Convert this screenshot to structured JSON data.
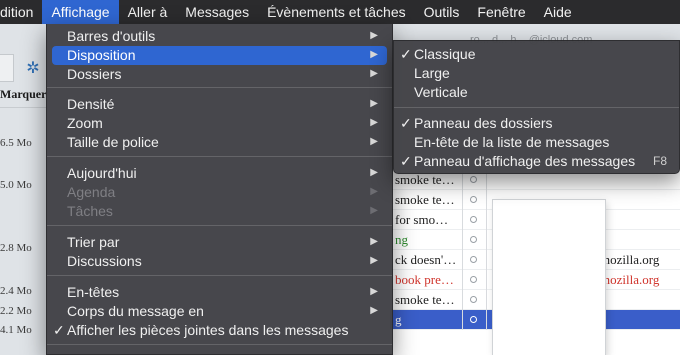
{
  "menubar": {
    "items": [
      {
        "label": "dition"
      },
      {
        "label": "Affichage"
      },
      {
        "label": "Aller à"
      },
      {
        "label": "Messages"
      },
      {
        "label": "Évènements et tâches"
      },
      {
        "label": "Outils"
      },
      {
        "label": "Fenêtre"
      },
      {
        "label": "Aide"
      }
    ]
  },
  "background": {
    "account_text": "ro... d... h... @icloud.com",
    "column_header": "Marquer",
    "sizes": [
      "6.5 Mo",
      "5.0 Mo",
      "2.8 Mo",
      "2.4 Mo",
      "2.2 Mo",
      "4.1 Mo"
    ],
    "rows": [
      {
        "subject": "smoke te…",
        "from": ""
      },
      {
        "subject": "smoke te…",
        "from": ""
      },
      {
        "subject": "for smo…",
        "from": ""
      },
      {
        "subject": "ng",
        "from": ""
      },
      {
        "subject": "ck doesn'…",
        "from": "mozilla.org"
      },
      {
        "subject": "book pre…",
        "from": "mozilla.org"
      },
      {
        "subject": "smoke te…",
        "from": ""
      },
      {
        "subject": "g",
        "from": ""
      }
    ]
  },
  "affichage_menu": {
    "items": [
      {
        "label": "Barres d'outils"
      },
      {
        "label": "Disposition"
      },
      {
        "label": "Dossiers"
      },
      {
        "label": "Densité"
      },
      {
        "label": "Zoom"
      },
      {
        "label": "Taille de police"
      },
      {
        "label": "Aujourd'hui"
      },
      {
        "label": "Agenda"
      },
      {
        "label": "Tâches"
      },
      {
        "label": "Trier par"
      },
      {
        "label": "Discussions"
      },
      {
        "label": "En-têtes"
      },
      {
        "label": "Corps du message en"
      },
      {
        "label": "Afficher les pièces jointes dans les messages"
      }
    ]
  },
  "disposition_menu": {
    "items": [
      {
        "label": "Classique"
      },
      {
        "label": "Large"
      },
      {
        "label": "Verticale"
      },
      {
        "label": "Panneau des dossiers"
      },
      {
        "label": "En-tête de la liste de messages"
      },
      {
        "label": "Panneau d'affichage des messages",
        "shortcut": "F8"
      }
    ]
  },
  "glyphs": {
    "check": "✓",
    "arrow": "▶",
    "gear": "✲"
  },
  "colors": {
    "highlight": "#2f66d1",
    "menu_bg": "#424246",
    "menubar_bg": "#2b2b2d",
    "red_text": "#d0342c"
  }
}
